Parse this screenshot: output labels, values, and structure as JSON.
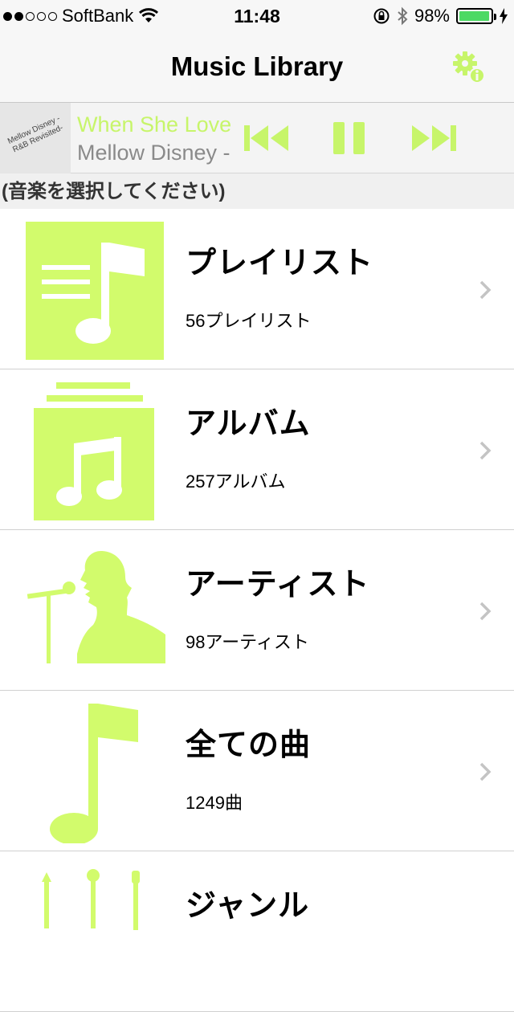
{
  "status": {
    "carrier": "SoftBank",
    "time": "11:48",
    "battery_text": "98%",
    "signal_bars_filled": 2,
    "signal_bars_total": 5,
    "battery_level": 0.98,
    "battery_color": "#4cd964"
  },
  "nav": {
    "title": "Music Library",
    "settings_icon": "gear-info-icon"
  },
  "now_playing": {
    "artwork_text_line1": "Mellow Disney -",
    "artwork_text_line2": "R&B Revisited-",
    "title": "When She Love",
    "artist": "Mellow Disney -",
    "controls": [
      "previous-icon",
      "pause-icon",
      "next-icon"
    ]
  },
  "section_label": "(音楽を選択してください)",
  "categories": [
    {
      "title": "プレイリスト",
      "subtitle": "56プレイリスト",
      "icon": "playlist-icon"
    },
    {
      "title": "アルバム",
      "subtitle": "257アルバム",
      "icon": "album-icon"
    },
    {
      "title": "アーティスト",
      "subtitle": "98アーティスト",
      "icon": "artist-icon"
    },
    {
      "title": "全ての曲",
      "subtitle": "1249曲",
      "icon": "song-icon"
    },
    {
      "title": "ジャンル",
      "subtitle": "",
      "icon": "genre-icon"
    }
  ],
  "colors": {
    "accent": "#c7f56a",
    "icon_fill": "#d2fb6c",
    "chevron": "#c4c4c4"
  }
}
